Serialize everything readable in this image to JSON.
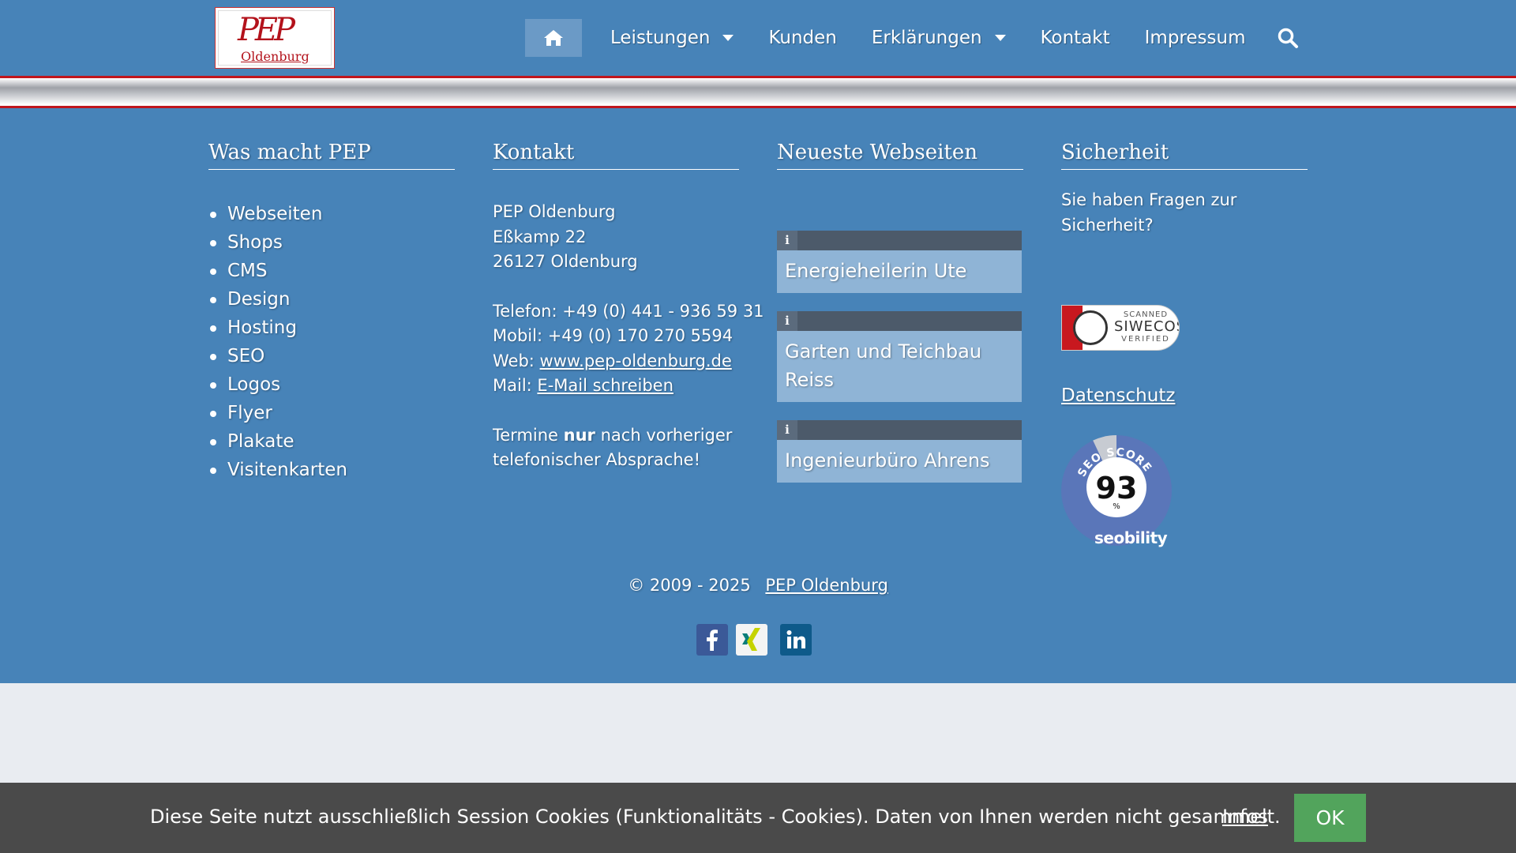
{
  "header": {
    "logo_text": "PEP",
    "logo_sub": "Oldenburg",
    "nav": {
      "home_icon": "home-icon",
      "items": [
        {
          "label": "Leistungen",
          "dropdown": true
        },
        {
          "label": "Kunden",
          "dropdown": false
        },
        {
          "label": "Erklärungen",
          "dropdown": true
        },
        {
          "label": "Kontakt",
          "dropdown": false
        },
        {
          "label": "Impressum",
          "dropdown": false
        }
      ],
      "search_icon": "search-icon"
    }
  },
  "footer": {
    "col1": {
      "title": "Was macht PEP",
      "items": [
        "Webseiten",
        "Shops",
        "CMS",
        "Design",
        "Hosting",
        "SEO",
        "Logos",
        "Flyer",
        "Plakate",
        "Visitenkarten"
      ]
    },
    "col2": {
      "title": "Kontakt",
      "name": "PEP Oldenburg",
      "street": "Eßkamp 22",
      "city": "26127 Oldenburg",
      "phone": "Telefon: +49 (0) 441 - 936 59 31",
      "mobile": "Mobil: +49 (0) 170 270 5594",
      "web_prefix": "Web:",
      "web_link": "www.pep-oldenburg.de",
      "mail_prefix": "Mail:",
      "mail_link": "E-Mail schreiben",
      "note_1": "Termine",
      "note_bold": "nur",
      "note_2": "nach vorheriger",
      "note_3": "telefonischer Absprache!"
    },
    "col3": {
      "title": "Neueste Webseiten",
      "info_glyph": "i",
      "items": [
        "Energieheilerin Ute",
        "Garten und Teichbau Reiss",
        "Ingenieurbüro Ahrens"
      ]
    },
    "col4": {
      "title": "Sicherheit",
      "question": "Sie haben Fragen zur Sicherheit?",
      "siwecos_top": "SCANNED",
      "siwecos_brand": "SIWECOS",
      "siwecos_bottom": "VERIFIED",
      "privacy_link": "Datenschutz",
      "seo_label": "SEO SCORE",
      "seo_score": "93",
      "seo_unit": "%",
      "seo_fraction": 0.93,
      "seo_brand": "seobility"
    },
    "copyright_text": "© 2009 - 2025",
    "copyright_link": "PEP Oldenburg",
    "social": [
      "facebook-icon",
      "xing-icon",
      "linkedin-icon"
    ]
  },
  "cookie": {
    "text": "Diese Seite nutzt ausschließlich Session Cookies (Funktionalitäts - Cookies). Daten von Ihnen werden nicht gesammelt.",
    "infos": "Infos",
    "ok": "OK"
  },
  "colors": {
    "primary_blue": "#4783b8",
    "accent_red": "#c0151c",
    "cookie_bar": "#4a4a4a",
    "ok_green": "#52a45c"
  }
}
